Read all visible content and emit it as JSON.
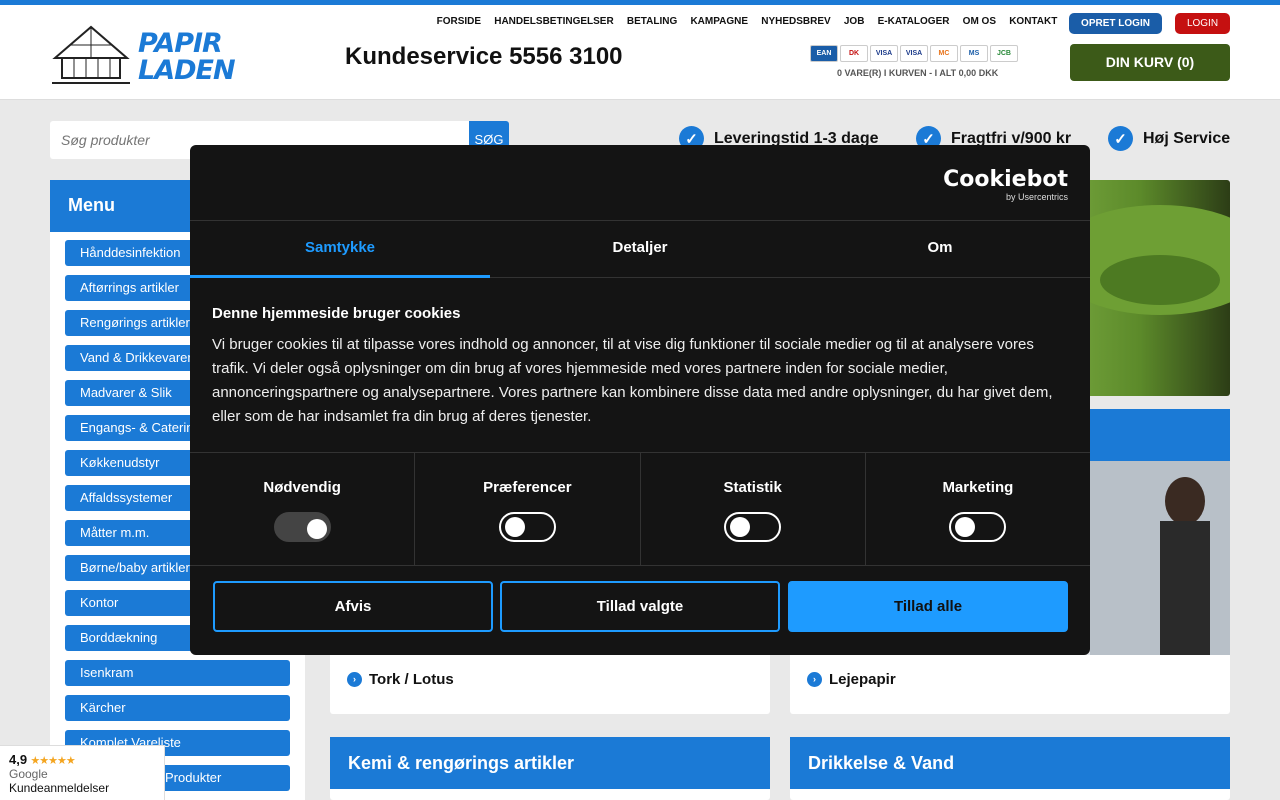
{
  "header": {
    "logo_line1": "PAPIR",
    "logo_line2": "LADEN",
    "phone": "Kundeservice  5556 3100",
    "nav": [
      "FORSIDE",
      "HANDELSBETINGELSER",
      "BETALING",
      "KAMPAGNE",
      "NYHEDSBREV",
      "JOB",
      "E-KATALOGER",
      "OM OS",
      "KONTAKT"
    ],
    "opret_login": "OPRET LOGIN",
    "login": "LOGIN",
    "payments": [
      "EAN",
      "DK",
      "VISA",
      "VISA",
      "MC",
      "MS",
      "JCB"
    ],
    "cart_info": "0 VARE(R) I KURVEN - I ALT 0,00 DKK",
    "cart_button": "DIN KURV (0)"
  },
  "search": {
    "placeholder": "Søg produkter",
    "button": "SØG"
  },
  "usps": [
    "Leveringstid 1-3 dage",
    "Fragtfri v/900 kr",
    "Høj Service"
  ],
  "sidebar": {
    "title": "Menu",
    "items": [
      "Hånddesinfektion",
      "Aftørrings artikler",
      "Rengørings artikler",
      "Vand & Drikkevarer",
      "Madvarer & Slik",
      "Engangs- & Catering",
      "Køkkenudstyr",
      "Affaldssystemer",
      "Måtter m.m.",
      "Børne/baby artikler",
      "Kontor",
      "Borddækning",
      "Isenkram",
      "Kärcher",
      "Komplet Vareliste",
      "Produkter"
    ]
  },
  "cards": [
    {
      "link": "Tork / Lotus"
    },
    {
      "link": "Lejepapir"
    },
    {
      "title": "Kemi & rengørings artikler"
    },
    {
      "title": "Drikkelse & Vand"
    }
  ],
  "cookie": {
    "brand": "Cookiebot",
    "brand_sub": "by Usercentrics",
    "tabs": [
      "Samtykke",
      "Detaljer",
      "Om"
    ],
    "heading": "Denne hjemmeside bruger cookies",
    "description": "Vi bruger cookies til at tilpasse vores indhold og annoncer, til at vise dig funktioner til sociale medier og til at analysere vores trafik. Vi deler også oplysninger om din brug af vores hjemmeside med vores partnere inden for sociale medier, annonceringspartnere og analysepartnere. Vores partnere kan kombinere disse data med andre oplysninger, du har givet dem, eller som de har indsamlet fra din brug af deres tjenester.",
    "categories": [
      "Nødvendig",
      "Præferencer",
      "Statistik",
      "Marketing"
    ],
    "buttons": {
      "deny": "Afvis",
      "allow_selected": "Tillad valgte",
      "allow_all": "Tillad alle"
    }
  },
  "google": {
    "rating": "4,9",
    "stars": "★★★★★",
    "brand": "Google",
    "label": "Kundeanmeldelser"
  }
}
